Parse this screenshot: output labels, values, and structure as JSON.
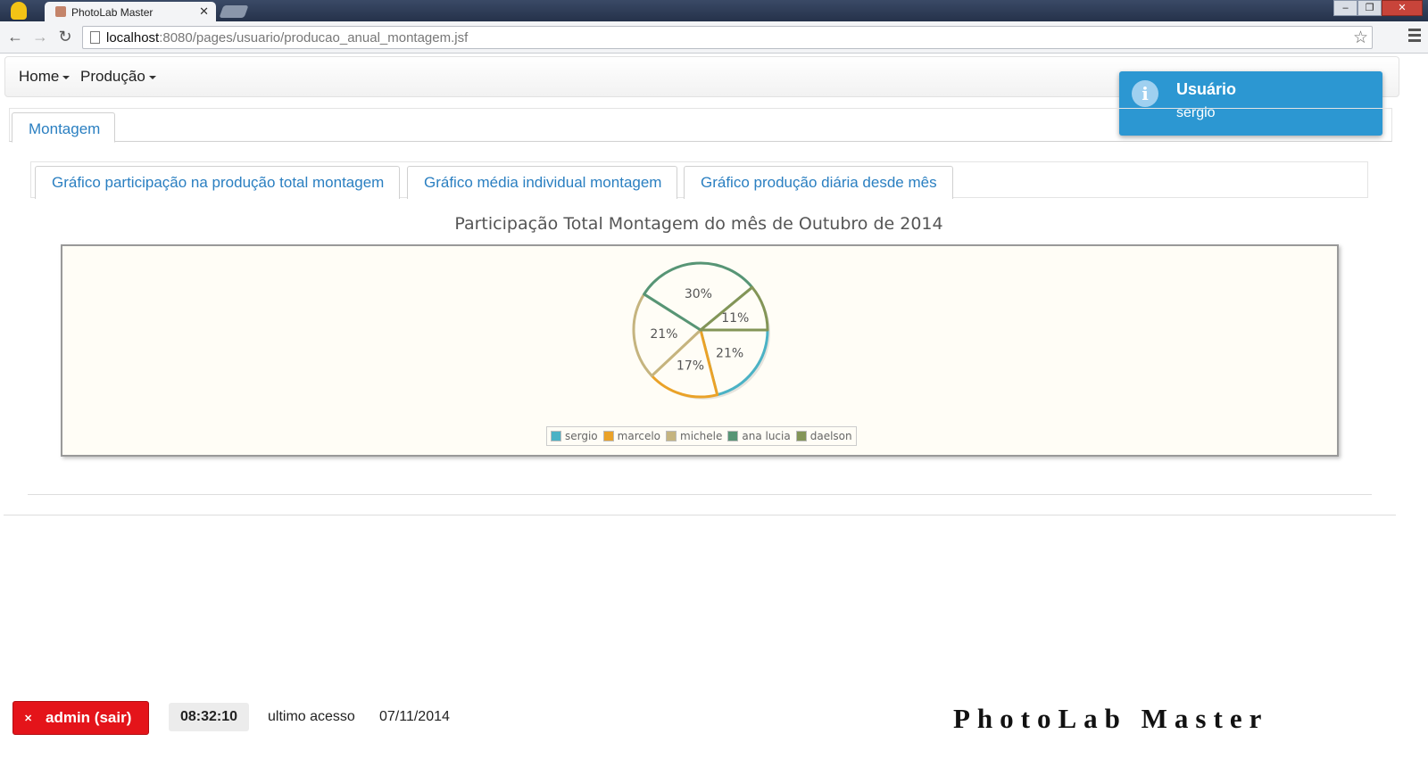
{
  "browser": {
    "tab_title": "PhotoLab Master",
    "url_host": "localhost",
    "url_path": ":8080/pages/usuario/producao_anual_montagem.jsf"
  },
  "menubar": {
    "items": [
      {
        "label": "Home"
      },
      {
        "label": "Produção"
      }
    ]
  },
  "notification": {
    "title": "Usuário",
    "message": "sergio"
  },
  "outer_tabs": [
    {
      "label": "Montagem",
      "active": true
    }
  ],
  "inner_tabs": [
    {
      "label": "Gráfico participação na produção total montagem",
      "active": true
    },
    {
      "label": "Gráfico média individual montagem"
    },
    {
      "label": "Gráfico produção diária desde mês"
    }
  ],
  "chart_data": {
    "type": "pie",
    "title": "Participação Total Montagem do mês de Outubro de 2014",
    "legend_position": "bottom",
    "categories": [
      "sergio",
      "marcelo",
      "michele",
      "ana lucia",
      "daelson"
    ],
    "values": [
      21,
      17,
      21,
      30,
      11
    ],
    "labels": [
      "21%",
      "17%",
      "21%",
      "30%",
      "11%"
    ],
    "colors": [
      "#4bb2c5",
      "#eaa228",
      "#c5b47f",
      "#579575",
      "#839557"
    ]
  },
  "footer": {
    "logout_label": "admin (sair)",
    "clock": "08:32:10",
    "last_access_label": "ultimo acesso",
    "last_access_date": "07/11/2014",
    "brand": "PhotoLab Master"
  }
}
